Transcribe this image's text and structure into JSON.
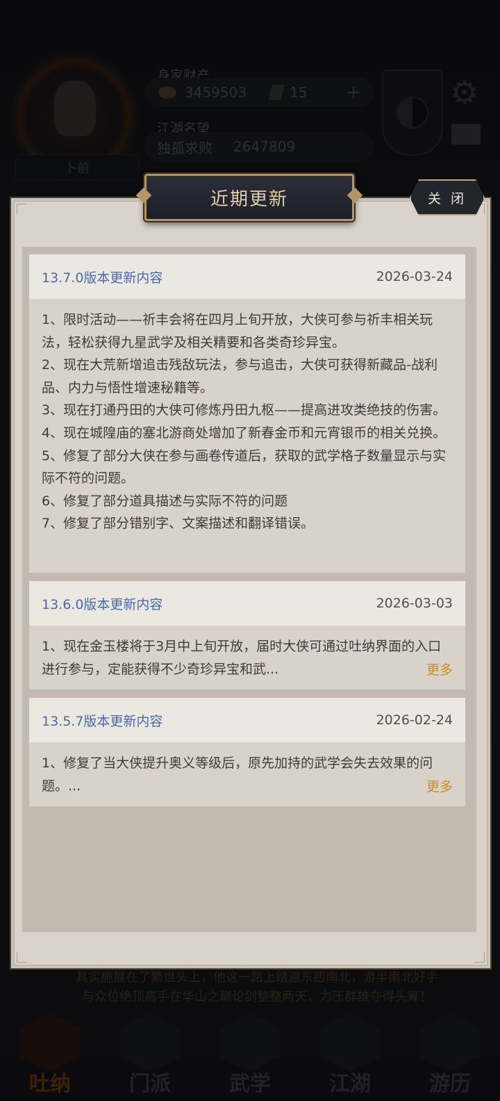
{
  "background": {
    "wealth_label": "身家财产",
    "coins": "3459503",
    "jade": "15",
    "plus": "+",
    "fame_label": "江湖名望",
    "fame_title": "独孤求败",
    "fame_value": "2647809",
    "name": "卜前",
    "bottom_text_1": "其实施展在了繁世头上，他这一路上踏遍东西南北，游半南北好手",
    "bottom_text_2": "与众位绝顶高手在华山之巅论剑整整两天，力压群雄夺得头筹！",
    "nav": [
      "吐纳",
      "门派",
      "武学",
      "江湖",
      "游历"
    ]
  },
  "modal": {
    "title": "近期更新",
    "close_label": "关 闭",
    "updates": [
      {
        "title": "13.7.0版本更新内容",
        "date": "2026-03-24",
        "lines": [
          "1、限时活动——祈丰会将在四月上旬开放，大侠可参与祈丰相关玩法，轻松获得九星武学及相关精要和各类奇珍异宝。",
          "2、现在大荒新增追击残敌玩法，参与追击，大侠可获得新藏品-战利品、内力与悟性增速秘籍等。",
          "3、现在打通丹田的大侠可修炼丹田九枢——提高进攻类绝技的伤害。",
          "4、现在城隍庙的塞北游商处增加了新春金币和元宵银币的相关兑换。",
          "5、修复了部分大侠在参与画卷传道后，获取的武学格子数量显示与实际不符的问题。",
          "6、修复了部分道具描述与实际不符的问题",
          "7、修复了部分错别字、文案描述和翻译错误。"
        ]
      },
      {
        "title": "13.6.0版本更新内容",
        "date": "2026-03-03",
        "summary": "1、现在金玉楼将于3月中上旬开放，届时大侠可通过吐纳界面的入口进行参与，定能获得不少奇珍异宝和武...",
        "more_label": "更多"
      },
      {
        "title": "13.5.7版本更新内容",
        "date": "2026-02-24",
        "summary": "1、修复了当大侠提升奥义等级后，原先加持的武学会失去效果的问题。...",
        "more_label": "更多"
      }
    ]
  }
}
